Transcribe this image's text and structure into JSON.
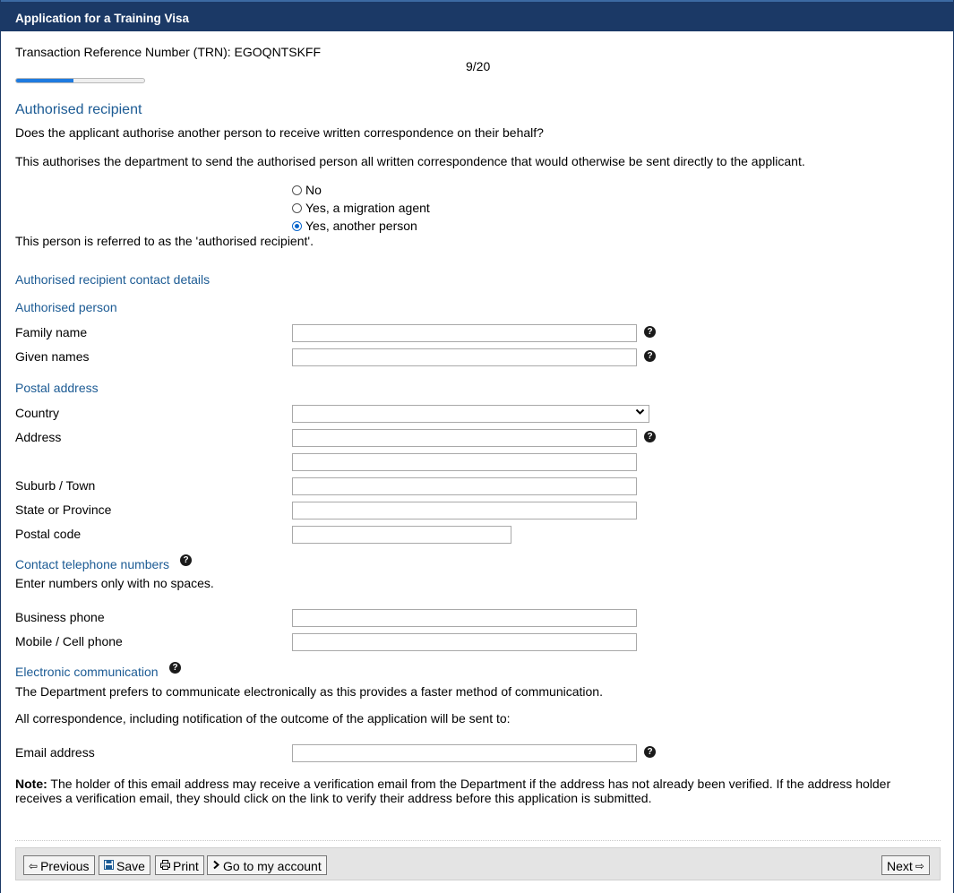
{
  "window": {
    "title": "Application for a Training Visa"
  },
  "trn": {
    "label": "Transaction Reference Number (TRN): EGOQNTSKFF"
  },
  "progress": {
    "text": "9/20",
    "fraction": 0.45
  },
  "authorised_recipient": {
    "heading": "Authorised recipient",
    "question": "Does the applicant authorise another person to receive written correspondence on their behalf?",
    "explanation": "This authorises the department to send the authorised person all written correspondence that would otherwise be sent directly to the applicant.",
    "options": [
      {
        "label": "No",
        "checked": false
      },
      {
        "label": "Yes, a migration agent",
        "checked": false
      },
      {
        "label": "Yes, another person",
        "checked": true
      }
    ],
    "referred_text": "This person is referred to as the 'authorised recipient'."
  },
  "contact_details": {
    "heading": "Authorised recipient contact details"
  },
  "authorised_person": {
    "heading": "Authorised person",
    "family_name_label": "Family name",
    "family_name_value": "",
    "given_names_label": "Given names",
    "given_names_value": ""
  },
  "postal_address": {
    "heading": "Postal address",
    "country_label": "Country",
    "country_value": "",
    "address_label": "Address",
    "address_line1": "",
    "address_line2": "",
    "suburb_label": "Suburb / Town",
    "suburb_value": "",
    "state_label": "State or Province",
    "state_value": "",
    "postal_code_label": "Postal code",
    "postal_code_value": ""
  },
  "telephone": {
    "heading": "Contact telephone numbers",
    "instruction": "Enter numbers only with no spaces.",
    "business_label": "Business phone",
    "business_value": "",
    "mobile_label": "Mobile / Cell phone",
    "mobile_value": ""
  },
  "electronic": {
    "heading": "Electronic communication",
    "prefers_text": "The Department prefers to communicate electronically as this provides a faster method of communication.",
    "correspondence_text": "All correspondence, including notification of the outcome of the application will be sent to:",
    "email_label": "Email address",
    "email_value": ""
  },
  "note": {
    "bold": "Note:",
    "text": " The holder of this email address may receive a verification email from the Department if the address has not already been verified. If the address holder receives a verification email, they should click on the link to verify their address before this application is submitted."
  },
  "footer": {
    "previous": "Previous",
    "save": "Save",
    "print": "Print",
    "account": "Go to my account",
    "next": "Next"
  },
  "help_glyph": "?"
}
